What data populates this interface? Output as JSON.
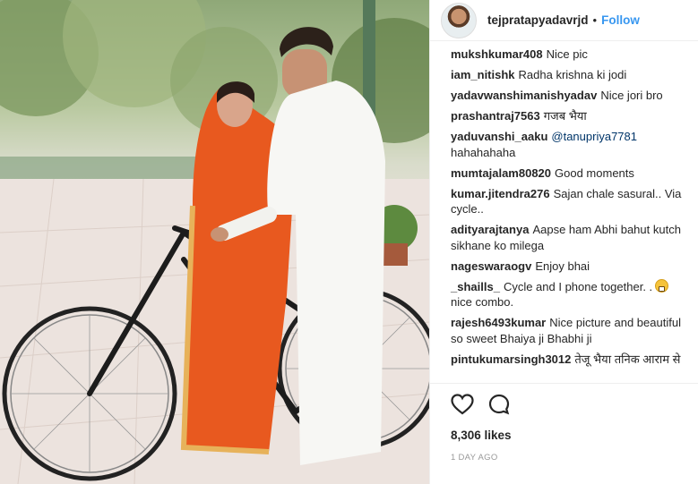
{
  "post": {
    "username": "tejpratapyadavrjd",
    "separator": "•",
    "follow_label": "Follow",
    "photo_alt": "Couple with a bicycle",
    "likes": "8,306 likes",
    "timestamp": "1 DAY AGO"
  },
  "comments": [
    {
      "user": "mukshkumar408",
      "text": "Nice pic"
    },
    {
      "user": "iam_nitishk",
      "text": "Radha krishna ki jodi"
    },
    {
      "user": "yadavwanshimanishyadav",
      "text": "Nice jori bro"
    },
    {
      "user": "prashantraj7563",
      "text": "गजब भैया"
    },
    {
      "user": "yaduvanshi_aaku",
      "mention": "@tanupriya7781",
      "text": "hahahahaha"
    },
    {
      "user": "mumtajalam80820",
      "text": "Good moments"
    },
    {
      "user": "kumar.jitendra276",
      "text": "Sajan chale sasural.. Via cycle.."
    },
    {
      "user": "adityarajtanya",
      "text": "Aapse ham Abhi bahut kutch sikhane ko milega"
    },
    {
      "user": "nageswaraogv",
      "text": "Enjoy bhai"
    },
    {
      "user": "_shaills_",
      "text": "Cycle and I phone together. .",
      "text2": "nice combo."
    },
    {
      "user": "rajesh6493kumar",
      "text": "Nice picture and beautiful so sweet Bhaiya ji Bhabhi ji"
    },
    {
      "user": "pintukumarsingh3012",
      "text": "तेजू भैया तनिक आराम से"
    }
  ],
  "icons": {
    "like": "heart-icon",
    "comment": "speech-bubble-icon",
    "emoji": "grinning-face-icon"
  },
  "colors": {
    "link": "#3897f0",
    "mention": "#003569",
    "saree": "#e8591f",
    "text": "#262626"
  }
}
